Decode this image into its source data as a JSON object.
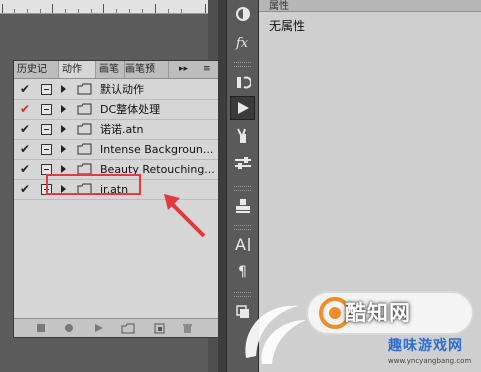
{
  "ruler": {
    "marks": [
      "-10",
      "0",
      "10",
      "20"
    ]
  },
  "actions_panel": {
    "tabs": [
      {
        "label": "历史记"
      },
      {
        "label": "动作"
      },
      {
        "label": "画笔"
      },
      {
        "label": "画笔预"
      }
    ],
    "collapse_label": "▸▸",
    "menu_label": "≡",
    "rows": [
      {
        "checked": true,
        "check_color": "#222222",
        "label": "默认动作",
        "expanded": false
      },
      {
        "checked": true,
        "check_color": "#d22a2a",
        "label": "DC整体处理",
        "expanded": false
      },
      {
        "checked": true,
        "check_color": "#222222",
        "label": "诺诺.atn",
        "expanded": false
      },
      {
        "checked": true,
        "check_color": "#222222",
        "label": "Intense Backgroun...",
        "expanded": false
      },
      {
        "checked": true,
        "check_color": "#222222",
        "label": "Beauty Retouching...",
        "expanded": false
      },
      {
        "checked": true,
        "check_color": "#222222",
        "label": "jr.atn",
        "expanded": false
      }
    ],
    "bottom_buttons": [
      "stop-icon",
      "record-icon",
      "play-icon",
      "new-set-icon",
      "new-action-icon",
      "delete-icon"
    ]
  },
  "tools": [
    "color-icon",
    "fx-icon",
    "history-brush-icon",
    "play-action-icon",
    "brush-tool-icon",
    "adjust-sliders-icon",
    "stamp-icon",
    "type-tool-icon",
    "paragraph-icon",
    "layers-icon"
  ],
  "properties_panel": {
    "tab_label": "属性",
    "title": "无属性"
  },
  "watermark": {
    "main": "酷知网",
    "sub": "趣味游戏网",
    "url": "www.yncyangbang.com"
  },
  "colors": {
    "highlight": "#e23b3b",
    "arrow": "#e23b3b"
  }
}
